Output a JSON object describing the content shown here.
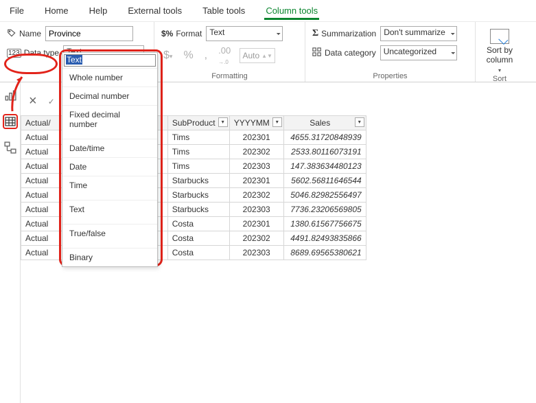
{
  "tabs": {
    "file": "File",
    "home": "Home",
    "help": "Help",
    "external": "External tools",
    "table": "Table tools",
    "column": "Column tools"
  },
  "ribbon": {
    "name_label": "Name",
    "name_value": "Province",
    "datatype_label": "Data type",
    "datatype_value": "Text",
    "format_label": "Format",
    "format_value": "Text",
    "auto_label": "Auto",
    "formatting_group": "Formatting",
    "summarization_label": "Summarization",
    "summarization_value": "Don't summarize",
    "datacategory_label": "Data category",
    "datacategory_value": "Uncategorized",
    "properties_group": "Properties",
    "sort_label1": "Sort by",
    "sort_label2": "column",
    "sort_group": "Sort"
  },
  "dropdown": {
    "selected": "Text",
    "options": [
      "Whole number",
      "Decimal number",
      "Fixed decimal number",
      "Date/time",
      "Date",
      "Time",
      "Text",
      "True/false",
      "Binary"
    ]
  },
  "table": {
    "headers": {
      "actual": "Actual/",
      "subproduct": "SubProduct",
      "yyyymm": "YYYYMM",
      "sales": "Sales"
    },
    "rows": [
      {
        "a": "Actual",
        "sp": "Tims",
        "ym": "202301",
        "s": "4655.31720848939"
      },
      {
        "a": "Actual",
        "sp": "Tims",
        "ym": "202302",
        "s": "2533.80116073191"
      },
      {
        "a": "Actual",
        "sp": "Tims",
        "ym": "202303",
        "s": "147.383634480123"
      },
      {
        "a": "Actual",
        "sp": "Starbucks",
        "ym": "202301",
        "s": "5602.56811646544"
      },
      {
        "a": "Actual",
        "sp": "Starbucks",
        "ym": "202302",
        "s": "5046.82982556497"
      },
      {
        "a": "Actual",
        "sp": "Starbucks",
        "ym": "202303",
        "s": "7736.23206569805"
      },
      {
        "a": "Actual",
        "sp": "Costa",
        "ym": "202301",
        "s": "1380.61567756675"
      },
      {
        "a": "Actual",
        "sp": "Costa",
        "ym": "202302",
        "s": "4491.82493835866"
      },
      {
        "a": "Actual",
        "sp": "Costa",
        "ym": "202303",
        "s": "8689.69565380621"
      }
    ]
  }
}
